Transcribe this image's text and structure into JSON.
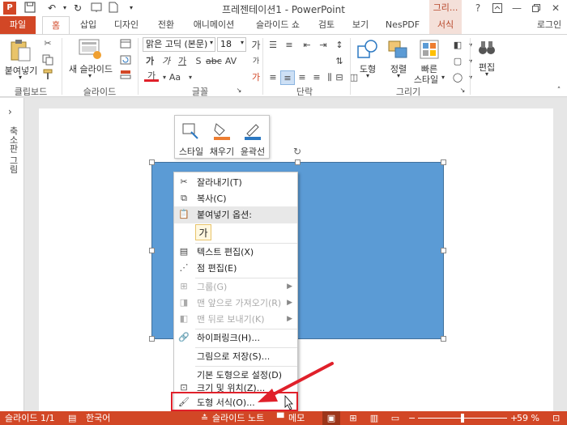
{
  "window": {
    "title": "프레젠테이션1 - PowerPoint",
    "context_group": "그리...",
    "help": "?",
    "logo": "P"
  },
  "tabs": [
    {
      "label": "파일"
    },
    {
      "label": "홈"
    },
    {
      "label": "삽입"
    },
    {
      "label": "디자인"
    },
    {
      "label": "전환"
    },
    {
      "label": "애니메이션"
    },
    {
      "label": "슬라이드 쇼"
    },
    {
      "label": "검토"
    },
    {
      "label": "보기"
    },
    {
      "label": "NesPDF"
    },
    {
      "label": "서식"
    },
    {
      "label": "로그인"
    }
  ],
  "ribbon": {
    "clipboard": {
      "paste": "붙여넣기",
      "group": "클립보드"
    },
    "slides": {
      "new_slide": "새 슬라이드",
      "group": "슬라이드"
    },
    "font": {
      "name": "맑은 고딕 (본문)",
      "size": "18",
      "group": "글꼴",
      "size_inc": "가",
      "size_dec": "가",
      "clear": "가",
      "spacing": "AV",
      "case": "Aa",
      "color_a": "가"
    },
    "paragraph": {
      "group": "단락"
    },
    "drawing": {
      "shape": "도형",
      "arrange": "정렬",
      "quick_style_1": "빠른",
      "quick_style_2": "스타일",
      "group": "그리기"
    },
    "editing": {
      "label": "편집"
    }
  },
  "left_pane": {
    "toggle": "›",
    "label": "축소판 그림"
  },
  "mini_toolbar": [
    {
      "label": "스타일"
    },
    {
      "label": "채우기"
    },
    {
      "label": "윤곽선"
    }
  ],
  "context_menu": {
    "cut": "잘라내기(T)",
    "copy": "복사(C)",
    "paste_options": "붙여넣기 옵션:",
    "paste_icon_text": "가",
    "edit_text": "텍스트 편집(X)",
    "edit_points": "점 편집(E)",
    "group": "그룹(G)",
    "bring_front": "맨 앞으로 가져오기(R)",
    "send_back": "맨 뒤로 보내기(K)",
    "hyperlink": "하이퍼링크(H)...",
    "save_picture": "그림으로 저장(S)...",
    "set_default": "기본 도형으로 설정(D)",
    "size_position": "크기 및 위치(Z)...",
    "format_shape": "도형 서식(O)..."
  },
  "status": {
    "slide": "슬라이드 1/1",
    "language": "한국어",
    "notes": "슬라이드 노트",
    "comments": "메모",
    "zoom": "59 %",
    "minus": "−",
    "plus": "+"
  },
  "colors": {
    "accent": "#d24726",
    "shape": "#5b9bd5",
    "highlight": "#e0202a"
  }
}
